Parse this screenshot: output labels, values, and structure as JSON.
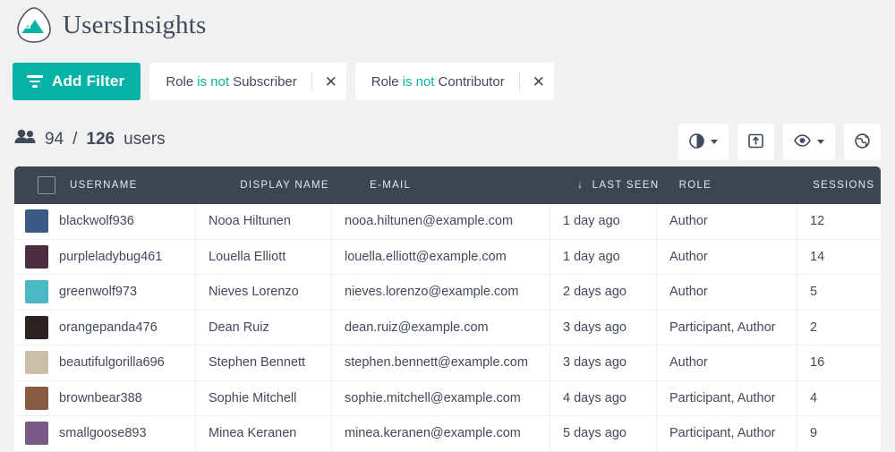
{
  "brand": {
    "name": "UsersInsights",
    "accent": "#04b3a5",
    "logo_icon": "mountain-logo-icon"
  },
  "filters": {
    "add_label": "Add Filter",
    "add_icon": "filter-icon",
    "chips": [
      {
        "field": "Role",
        "operator": "is not",
        "value": "Subscriber",
        "remove_icon": "close-icon"
      },
      {
        "field": "Role",
        "operator": "is not",
        "value": "Contributor",
        "remove_icon": "close-icon"
      }
    ]
  },
  "summary": {
    "icon": "people-icon",
    "filtered": "94",
    "separator": "/",
    "total": "126",
    "unit": "users"
  },
  "toolbar": {
    "buttons": [
      {
        "name": "charts-button",
        "icon": "pie-chart-icon",
        "has_caret": true
      },
      {
        "name": "export-button",
        "icon": "export-icon",
        "has_caret": false
      },
      {
        "name": "visible-columns-button",
        "icon": "eye-icon",
        "has_caret": true
      },
      {
        "name": "map-button",
        "icon": "globe-icon",
        "has_caret": false
      }
    ]
  },
  "table": {
    "select_all_checkbox": "select-all-checkbox",
    "sort": {
      "column": "LAST SEEN",
      "direction": "desc",
      "arrow": "↓"
    },
    "columns": [
      {
        "key": "username",
        "label": "USERNAME"
      },
      {
        "key": "display_name",
        "label": "DISPLAY NAME"
      },
      {
        "key": "email",
        "label": "E-MAIL"
      },
      {
        "key": "last_seen",
        "label": "LAST SEEN"
      },
      {
        "key": "role",
        "label": "ROLE"
      },
      {
        "key": "sessions",
        "label": "SESSIONS"
      }
    ],
    "rows": [
      {
        "username": "blackwolf936",
        "display_name": "Nooa Hiltunen",
        "email": "nooa.hiltunen@example.com",
        "last_seen": "1 day ago",
        "role": "Author",
        "sessions": "12",
        "avatar_color": "#3c5a86"
      },
      {
        "username": "purpleladybug461",
        "display_name": "Louella Elliott",
        "email": "louella.elliott@example.com",
        "last_seen": "1 day ago",
        "role": "Author",
        "sessions": "14",
        "avatar_color": "#4b2d3f"
      },
      {
        "username": "greenwolf973",
        "display_name": "Nieves Lorenzo",
        "email": "nieves.lorenzo@example.com",
        "last_seen": "2 days ago",
        "role": "Author",
        "sessions": "5",
        "avatar_color": "#4bb9c4"
      },
      {
        "username": "orangepanda476",
        "display_name": "Dean Ruiz",
        "email": "dean.ruiz@example.com",
        "last_seen": "3 days ago",
        "role": "Participant, Author",
        "sessions": "2",
        "avatar_color": "#2e2320"
      },
      {
        "username": "beautifulgorilla696",
        "display_name": "Stephen Bennett",
        "email": "stephen.bennett@example.com",
        "last_seen": "3 days ago",
        "role": "Author",
        "sessions": "16",
        "avatar_color": "#c9bfa8"
      },
      {
        "username": "brownbear388",
        "display_name": "Sophie Mitchell",
        "email": "sophie.mitchell@example.com",
        "last_seen": "4 days ago",
        "role": "Participant, Author",
        "sessions": "4",
        "avatar_color": "#8a5a43"
      },
      {
        "username": "smallgoose893",
        "display_name": "Minea Keranen",
        "email": "minea.keranen@example.com",
        "last_seen": "5 days ago",
        "role": "Participant, Author",
        "sessions": "9",
        "avatar_color": "#7a5a86"
      }
    ]
  }
}
